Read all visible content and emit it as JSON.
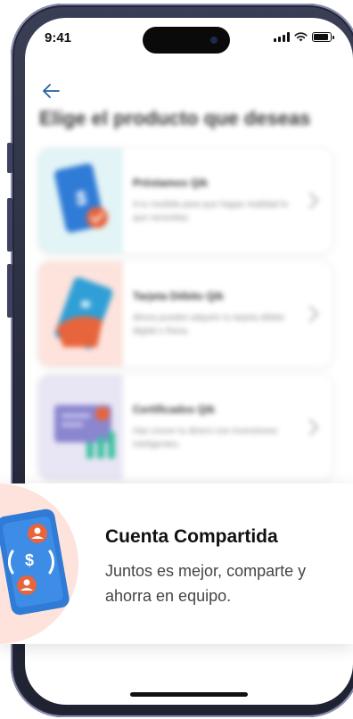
{
  "status_bar": {
    "time": "9:41"
  },
  "page": {
    "title": "Elige el producto que deseas"
  },
  "products": [
    {
      "title": "Préstamos Qik",
      "description": "A tu medida para que hagas realidad lo que necesitas."
    },
    {
      "title": "Tarjeta Débito Qik",
      "description": "Ahora puedes adquirir tu tarjeta débito digital o física."
    },
    {
      "title": "Certificados Qik",
      "description": "Haz crecer tu dinero con inversiones inteligentes."
    }
  ],
  "featured": {
    "title": "Cuenta Compartida",
    "description": "Juntos es mejor, comparte y ahorra en equipo."
  },
  "colors": {
    "accent_orange": "#e8643c",
    "accent_blue": "#2f7bd6",
    "teal_bg": "#e2f4f6",
    "peach_bg": "#fde3dc",
    "lavender_bg": "#e8e6f4"
  },
  "icons": [
    "back-arrow-icon",
    "chevron-right-icon",
    "signal-icon",
    "wifi-icon",
    "battery-icon"
  ]
}
